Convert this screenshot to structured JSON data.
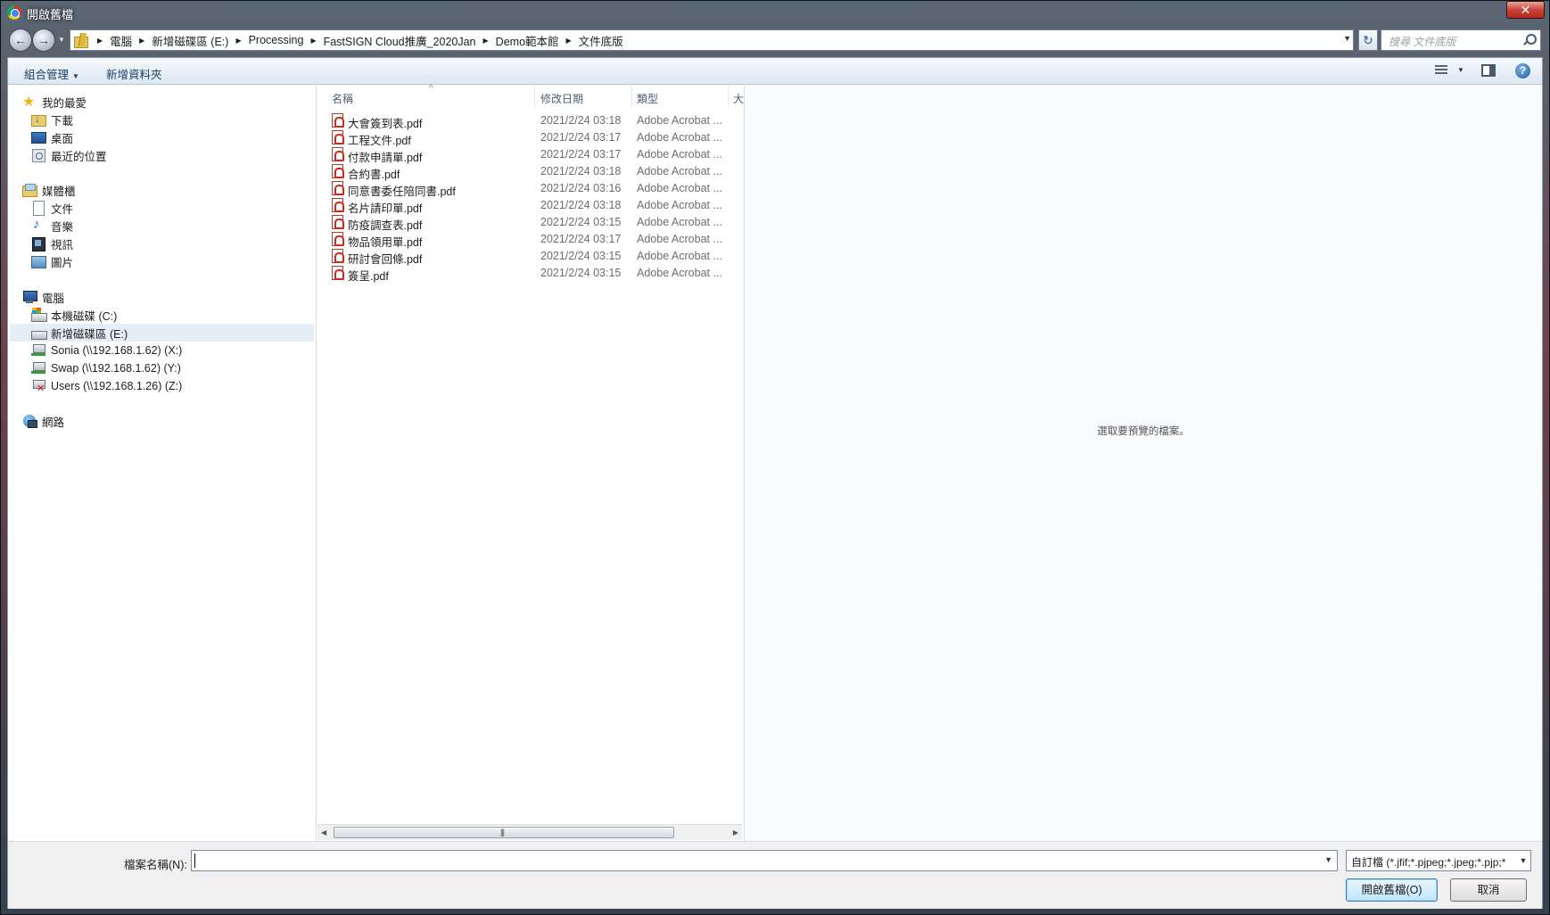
{
  "window": {
    "title": "開啟舊檔",
    "close_label": "✕"
  },
  "address": {
    "crumbs": [
      "電腦",
      "新增磁碟區 (E:)",
      "Processing",
      "FastSIGN Cloud推廣_2020Jan",
      "Demo範本館",
      "文件底版"
    ],
    "search_placeholder": "搜尋 文件底版"
  },
  "toolbar": {
    "organize_label": "組合管理",
    "new_folder_label": "新增資料夾",
    "help_label": "?"
  },
  "nav": {
    "favorites": {
      "label": "我的最愛",
      "items": [
        "下載",
        "桌面",
        "最近的位置"
      ]
    },
    "libraries": {
      "label": "媒體櫃",
      "items": [
        "文件",
        "音樂",
        "視訊",
        "圖片"
      ]
    },
    "computer": {
      "label": "電腦",
      "items": [
        "本機磁碟 (C:)",
        "新增磁碟區 (E:)",
        "Sonia (\\\\192.168.1.62) (X:)",
        "Swap (\\\\192.168.1.62) (Y:)",
        "Users (\\\\192.168.1.26) (Z:)"
      ]
    },
    "network": {
      "label": "網路"
    }
  },
  "columns": {
    "name": "名稱",
    "modified": "修改日期",
    "type": "類型",
    "size": "大"
  },
  "files": [
    {
      "name": "大會簽到表.pdf",
      "date": "2021/2/24 03:18",
      "type": "Adobe Acrobat ..."
    },
    {
      "name": "工程文件.pdf",
      "date": "2021/2/24 03:17",
      "type": "Adobe Acrobat ..."
    },
    {
      "name": "付款申請單.pdf",
      "date": "2021/2/24 03:17",
      "type": "Adobe Acrobat ..."
    },
    {
      "name": "合約書.pdf",
      "date": "2021/2/24 03:18",
      "type": "Adobe Acrobat ..."
    },
    {
      "name": "同意書委任陪同書.pdf",
      "date": "2021/2/24 03:16",
      "type": "Adobe Acrobat ..."
    },
    {
      "name": "名片請印單.pdf",
      "date": "2021/2/24 03:18",
      "type": "Adobe Acrobat ..."
    },
    {
      "name": "防疫調查表.pdf",
      "date": "2021/2/24 03:15",
      "type": "Adobe Acrobat ..."
    },
    {
      "name": "物品領用單.pdf",
      "date": "2021/2/24 03:17",
      "type": "Adobe Acrobat ..."
    },
    {
      "name": "研討會回條.pdf",
      "date": "2021/2/24 03:15",
      "type": "Adobe Acrobat ..."
    },
    {
      "name": "簽呈.pdf",
      "date": "2021/2/24 03:15",
      "type": "Adobe Acrobat ..."
    }
  ],
  "preview": {
    "message": "選取要預覽的檔案。"
  },
  "bottom": {
    "filename_label": "檔案名稱(N):",
    "filename_value": "",
    "filter": "自訂檔 (*.jfif;*.pjpeg;*.jpeg;*.pjp;*",
    "open_label": "開啟舊檔(O)",
    "cancel_label": "取消"
  }
}
